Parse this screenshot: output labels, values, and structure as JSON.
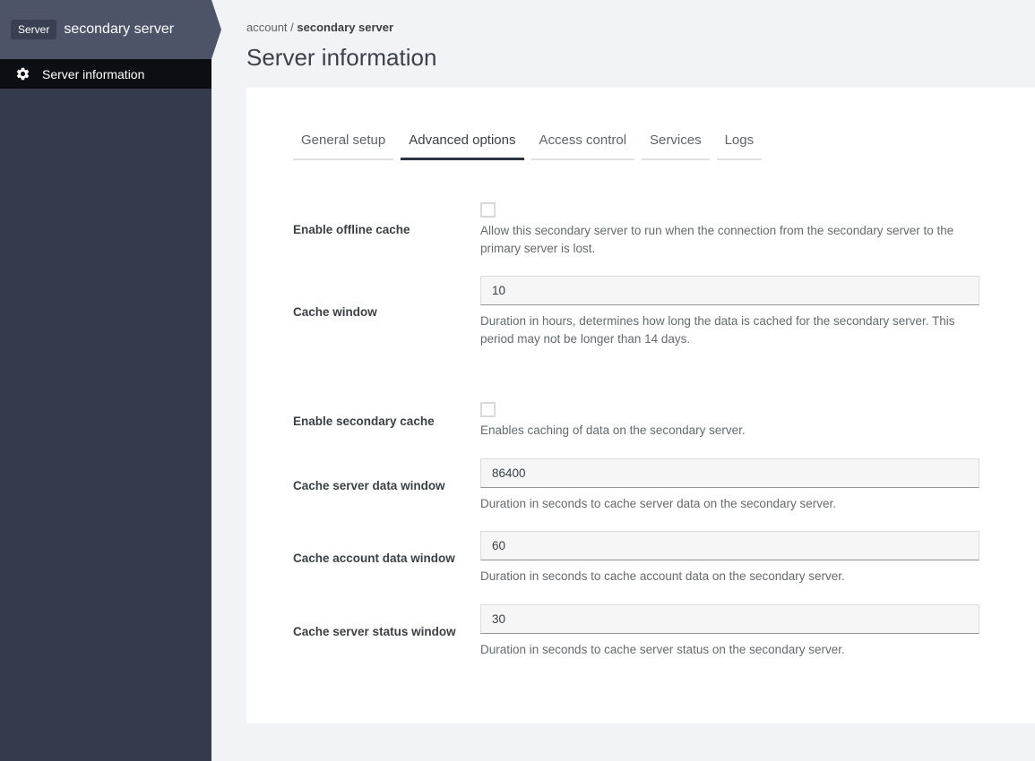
{
  "sidebar": {
    "badge": "Server",
    "server_name": "secondary server",
    "menu": [
      {
        "label": "Server information",
        "icon": "gear-icon"
      }
    ]
  },
  "breadcrumb": {
    "parent": "account",
    "separator": " / ",
    "current": "secondary server"
  },
  "page": {
    "title": "Server information"
  },
  "tabs": [
    {
      "label": "General setup",
      "active": false
    },
    {
      "label": "Advanced options",
      "active": true
    },
    {
      "label": "Access control",
      "active": false
    },
    {
      "label": "Services",
      "active": false
    },
    {
      "label": "Logs",
      "active": false
    }
  ],
  "form": {
    "fields": [
      {
        "type": "checkbox",
        "label": "Enable offline cache",
        "checked": false,
        "description": "Allow this secondary server to run when the connection from the secondary server to the primary server is lost."
      },
      {
        "type": "text",
        "label": "Cache window",
        "value": "10",
        "description": "Duration in hours, determines how long the data is cached for the secondary server. This period may not be longer than 14 days."
      },
      {
        "type": "checkbox",
        "label": "Enable secondary cache",
        "checked": false,
        "section_break": true,
        "description": "Enables caching of data on the secondary server."
      },
      {
        "type": "text",
        "label": "Cache server data window",
        "value": "86400",
        "description": "Duration in seconds to cache server data on the secondary server."
      },
      {
        "type": "text",
        "label": "Cache account data window",
        "value": "60",
        "description": "Duration in seconds to cache account data on the secondary server."
      },
      {
        "type": "text",
        "label": "Cache server status window",
        "value": "30",
        "description": "Duration in seconds to cache server status on the secondary server."
      }
    ]
  },
  "colors": {
    "page_bg": "#f2f3f6",
    "card_bg": "#ffffff",
    "sidebar_bg": "#353b4c",
    "sidebar_header_bg": "#4e5468",
    "badge_bg": "#3a3f51",
    "menu_item_bg": "#0c0e13",
    "active_tab_underline": "#2c3345",
    "input_bg": "#f6f6f6"
  }
}
